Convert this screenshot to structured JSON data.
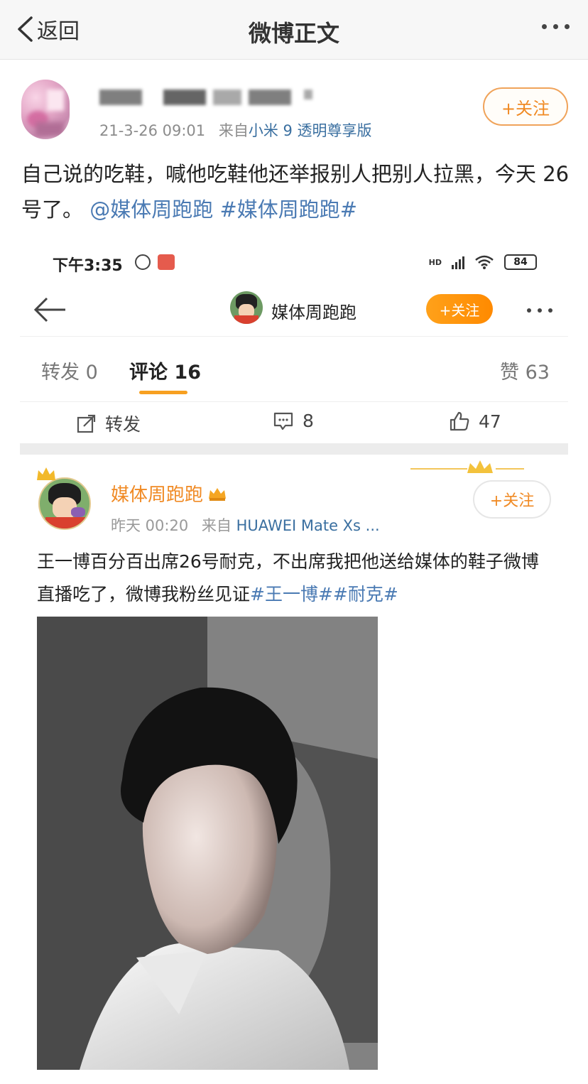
{
  "topnav": {
    "back_label": "返回",
    "title": "微博正文"
  },
  "post": {
    "timestamp": "21-3-26 09:01",
    "source_prefix": "来自",
    "source": "小米 9 透明尊享版",
    "follow_label": "+关注",
    "text_plain": "自己说的吃鞋，喊他吃鞋他还举报别人把别人拉黑，今天 26 号了。",
    "mention": "@媒体周跑跑",
    "hashtag": "#媒体周跑跑#"
  },
  "screenshot": {
    "status": {
      "time": "下午3:35",
      "hd": "HD",
      "battery": "84"
    },
    "header": {
      "name": "媒体周跑跑",
      "follow_label": "+关注"
    },
    "tabs": [
      {
        "label": "转发",
        "count": "0"
      },
      {
        "label": "评论",
        "count": "16"
      },
      {
        "label": "赞",
        "count": "63"
      }
    ],
    "actions": {
      "repost": "转发",
      "comments": "8",
      "likes": "47"
    },
    "comment": {
      "name": "媒体周跑跑",
      "time": "昨天 00:20",
      "source_prefix": "来自",
      "source": "HUAWEI Mate Xs ...",
      "follow_label": "+关注",
      "text_plain": "王一博百分百出席26号耐克，不出席我把他送给媒体的鞋子微博直播吃了，微博我粉丝见证",
      "hashtag1": "#王一博#",
      "hashtag2": "#耐克#"
    }
  },
  "colors": {
    "accent_orange": "#f08a24",
    "link_blue": "#4a7ab3",
    "tab_underline": "#f7a021"
  }
}
